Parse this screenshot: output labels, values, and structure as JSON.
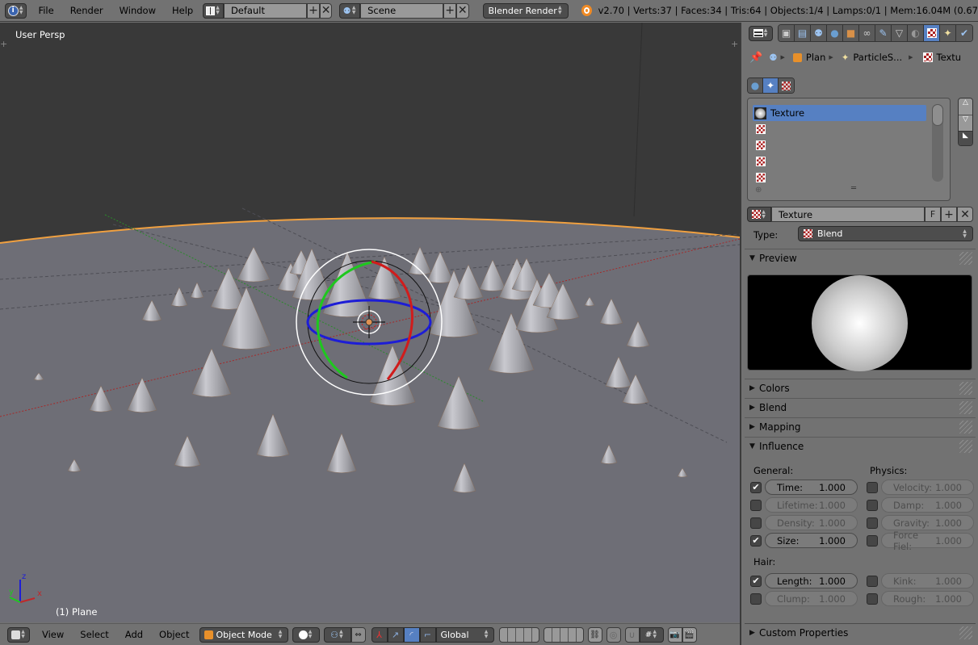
{
  "topbar": {
    "menus": [
      "File",
      "Render",
      "Window",
      "Help"
    ],
    "layout_name": "Default",
    "scene_name": "Scene",
    "engine": "Blender Render",
    "stats": "v2.70 | Verts:37 | Faces:34 | Tris:64 | Objects:1/4 | Lamps:0/1 | Mem:16.04M (0.67"
  },
  "viewport": {
    "view_label": "User Persp",
    "object_label": "(1) Plane",
    "axes": {
      "x": "x",
      "y": "y",
      "z": "z"
    },
    "colors": {
      "x_axis": "#c0282a",
      "y_axis": "#2aa52a",
      "z_axis": "#1d1dd6",
      "selection_outline": "#f0a040",
      "background_top": "#393939",
      "ground": "#6e6e76"
    }
  },
  "bottombar": {
    "menus": [
      "View",
      "Select",
      "Add",
      "Object"
    ],
    "mode": "Object Mode",
    "orientation": "Global"
  },
  "properties": {
    "tabs": [
      "render",
      "render-layers",
      "scene",
      "world",
      "object",
      "constraints",
      "modifiers",
      "data",
      "material",
      "texture",
      "particles",
      "physics"
    ],
    "active_tab": "texture",
    "breadcrumb": [
      {
        "icon": "cube-icon",
        "label": "Plan"
      },
      {
        "icon": "particles-icon",
        "label": "ParticleS..."
      },
      {
        "icon": "texture-icon",
        "label": "Textu"
      }
    ],
    "texture_context_tabs": [
      "world",
      "particles",
      "texture"
    ],
    "active_context": "particles",
    "texture_slots": [
      {
        "label": "Texture",
        "selected": true,
        "icon": "blend-sphere"
      },
      {
        "label": "",
        "selected": false,
        "icon": "checker"
      },
      {
        "label": "",
        "selected": false,
        "icon": "checker"
      },
      {
        "label": "",
        "selected": false,
        "icon": "checker"
      },
      {
        "label": "",
        "selected": false,
        "icon": "checker"
      }
    ],
    "datablock": {
      "name": "Texture",
      "fake_user_label": "F"
    },
    "type": {
      "label": "Type:",
      "value": "Blend"
    },
    "panels": {
      "preview": "Preview",
      "colors": "Colors",
      "blend": "Blend",
      "mapping": "Mapping",
      "influence": "Influence",
      "custom": "Custom Properties"
    },
    "influence": {
      "general_label": "General:",
      "physics_label": "Physics:",
      "hair_label": "Hair:",
      "general": [
        {
          "label": "Time:",
          "value": "1.000",
          "checked": true
        },
        {
          "label": "Lifetime:",
          "value": "1.000",
          "checked": false
        },
        {
          "label": "Density:",
          "value": "1.000",
          "checked": false
        },
        {
          "label": "Size:",
          "value": "1.000",
          "checked": true
        }
      ],
      "physics": [
        {
          "label": "Velocity:",
          "value": "1.000",
          "checked": false
        },
        {
          "label": "Damp:",
          "value": "1.000",
          "checked": false
        },
        {
          "label": "Gravity:",
          "value": "1.000",
          "checked": false
        },
        {
          "label": "Force Fiel:",
          "value": "1.000",
          "checked": false
        }
      ],
      "hair_left": [
        {
          "label": "Length:",
          "value": "1.000",
          "checked": true
        },
        {
          "label": "Clump:",
          "value": "1.000",
          "checked": false
        }
      ],
      "hair_right": [
        {
          "label": "Kink:",
          "value": "1.000",
          "checked": false
        },
        {
          "label": "Rough:",
          "value": "1.000",
          "checked": false
        }
      ]
    },
    "accent": "#5680c2"
  }
}
